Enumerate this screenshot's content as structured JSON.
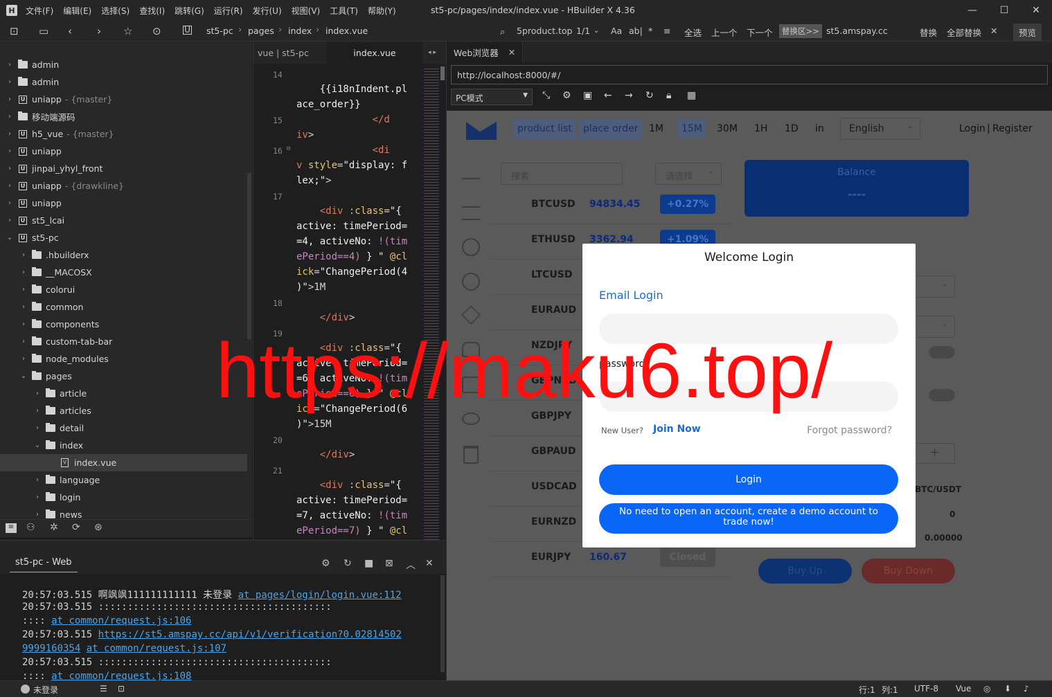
{
  "window": {
    "title": "st5-pc/pages/index/index.vue - HBuilder X 4.36",
    "logo": "H",
    "menu": [
      "文件(F)",
      "编辑(E)",
      "选择(S)",
      "查找(I)",
      "跳转(G)",
      "运行(R)",
      "发行(U)",
      "视图(V)",
      "工具(T)",
      "帮助(Y)"
    ],
    "controls": {
      "minimize": "—",
      "maximize": "☐",
      "close": "✕"
    }
  },
  "toolbar": {
    "breadcrumb": [
      "st5-pc",
      "pages",
      "index",
      "index.vue"
    ],
    "search_value": "5product.top",
    "search_count": "1/1",
    "search_options": [
      "Aa",
      "аb|",
      "*"
    ],
    "select_all": "全选",
    "prev": "上一个",
    "next": "下一个",
    "replace_area": "替换区>>",
    "replace_value": "st5.amspay.cc",
    "replace": "替换",
    "replace_all": "全部替换",
    "preview": "预览"
  },
  "sidebar": {
    "items": [
      {
        "label": "admin",
        "type": "folder",
        "depth": 0,
        "expanded": false,
        "branch": ""
      },
      {
        "label": "admin",
        "type": "folder",
        "depth": 0,
        "expanded": false,
        "branch": ""
      },
      {
        "label": "uniapp",
        "type": "uniapp",
        "depth": 0,
        "expanded": false,
        "branch": "- {master}"
      },
      {
        "label": "移动端源码",
        "type": "folder",
        "depth": 0,
        "expanded": false,
        "branch": ""
      },
      {
        "label": "h5_vue",
        "type": "uniapp",
        "depth": 0,
        "expanded": false,
        "branch": "- {master}"
      },
      {
        "label": "uniapp",
        "type": "uniapp",
        "depth": 0,
        "expanded": false,
        "branch": ""
      },
      {
        "label": "jinpai_yhyl_front",
        "type": "uniapp",
        "depth": 0,
        "expanded": false,
        "branch": ""
      },
      {
        "label": "uniapp",
        "type": "uniapp",
        "depth": 0,
        "expanded": false,
        "branch": "- {drawkline}"
      },
      {
        "label": "uniapp",
        "type": "uniapp",
        "depth": 0,
        "expanded": false,
        "branch": ""
      },
      {
        "label": "st5_lcai",
        "type": "uniapp",
        "depth": 0,
        "expanded": false,
        "branch": ""
      },
      {
        "label": "st5-pc",
        "type": "uniapp",
        "depth": 0,
        "expanded": true,
        "branch": ""
      },
      {
        "label": ".hbuilderx",
        "type": "folder",
        "depth": 1,
        "expanded": false,
        "branch": ""
      },
      {
        "label": "__MACOSX",
        "type": "folder",
        "depth": 1,
        "expanded": false,
        "branch": ""
      },
      {
        "label": "colorui",
        "type": "folder",
        "depth": 1,
        "expanded": false,
        "branch": ""
      },
      {
        "label": "common",
        "type": "folder",
        "depth": 1,
        "expanded": false,
        "branch": ""
      },
      {
        "label": "components",
        "type": "folder",
        "depth": 1,
        "expanded": false,
        "branch": ""
      },
      {
        "label": "custom-tab-bar",
        "type": "folder",
        "depth": 1,
        "expanded": false,
        "branch": ""
      },
      {
        "label": "node_modules",
        "type": "folder",
        "depth": 1,
        "expanded": false,
        "branch": ""
      },
      {
        "label": "pages",
        "type": "folder",
        "depth": 1,
        "expanded": true,
        "branch": ""
      },
      {
        "label": "article",
        "type": "folder",
        "depth": 2,
        "expanded": false,
        "branch": ""
      },
      {
        "label": "articles",
        "type": "folder",
        "depth": 2,
        "expanded": false,
        "branch": ""
      },
      {
        "label": "detail",
        "type": "folder",
        "depth": 2,
        "expanded": false,
        "branch": ""
      },
      {
        "label": "index",
        "type": "folder",
        "depth": 2,
        "expanded": true,
        "branch": ""
      },
      {
        "label": "index.vue",
        "type": "file",
        "depth": 3,
        "expanded": false,
        "branch": "",
        "selected": true
      },
      {
        "label": "language",
        "type": "folder",
        "depth": 2,
        "expanded": false,
        "branch": ""
      },
      {
        "label": "login",
        "type": "folder",
        "depth": 2,
        "expanded": false,
        "branch": ""
      },
      {
        "label": "news",
        "type": "folder",
        "depth": 2,
        "expanded": false,
        "branch": ""
      }
    ]
  },
  "editor": {
    "tabs": [
      {
        "label": "vue | st5-pc",
        "active": false
      },
      {
        "label": "index.vue",
        "active": true
      }
    ],
    "line_numbers": [
      "14",
      "15",
      "16",
      "17",
      "18",
      "19",
      "20",
      "21"
    ]
  },
  "panel": {
    "tab": "st5-pc - Web",
    "logs": [
      {
        "time": "20:57:03.515",
        "text": " 啊飒飒111111111111 未登录 ",
        "link": "at pages/login/login.vue:112"
      },
      {
        "time": "20:57:03.515",
        "text": " ::::::::::::::::::::::::::::::::::::::::",
        "link": ""
      },
      {
        "time": "",
        "text": ":::: ",
        "link": "at common/request.js:106"
      },
      {
        "time": "20:57:03.515",
        "text": " ",
        "link": "https://st5.amspay.cc/api/v1/verification?0.02814502"
      },
      {
        "time": "",
        "text": "",
        "link": "9999160354",
        "link2": "at common/request.js:107"
      },
      {
        "time": "20:57:03.515",
        "text": " ::::::::::::::::::::::::::::::::::::::::",
        "link": ""
      },
      {
        "time": "",
        "text": ":::: ",
        "link": "at common/request.js:108"
      }
    ]
  },
  "statusbar": {
    "login": "未登录",
    "line": "行:1",
    "col": "列:1",
    "encoding": "UTF-8",
    "lang": "Vue"
  },
  "browser": {
    "tab": "Web浏览器",
    "url": "http://localhost:8000/#/",
    "mode": "PC模式"
  },
  "site": {
    "nav": {
      "product_list": "product list",
      "place_order": "place order",
      "periods": [
        "1M",
        "15M",
        "30M",
        "1H",
        "1D"
      ],
      "in": "in",
      "language": "English",
      "login": "Login",
      "register": "Register"
    },
    "search_placeholder": "搜索",
    "select_placeholder": "请选择",
    "balance_label": "Balance",
    "balance_value": "----",
    "markets": [
      {
        "pair": "BTCUSD",
        "price": "94834.45",
        "change": "+0.27%"
      },
      {
        "pair": "ETHUSD",
        "price": "3362.94",
        "change": "+1.09%"
      },
      {
        "pair": "LTCUSD",
        "price": "",
        "change": ""
      },
      {
        "pair": "EURAUD",
        "price": "",
        "change": ""
      },
      {
        "pair": "NZDJPY",
        "price": "",
        "change": ""
      },
      {
        "pair": "GBPNZD",
        "price": "",
        "change": ""
      },
      {
        "pair": "GBPJPY",
        "price": "",
        "change": ""
      },
      {
        "pair": "GBPAUD",
        "price": "",
        "change": ""
      },
      {
        "pair": "USDCAD",
        "price": "",
        "change": ""
      },
      {
        "pair": "EURNZD",
        "price": "",
        "change": ""
      },
      {
        "pair": "EURJPY",
        "price": "160.67",
        "change": "Closed"
      }
    ],
    "right_panel": {
      "symbol": "BTC/USDT",
      "qty": "0",
      "amount": "0.00000",
      "buy_up": "Buy Up",
      "buy_down": "Buy Down"
    },
    "modal": {
      "title": "Welcome Login",
      "email_tab": "Email Login",
      "password_label": "password",
      "new_user": "New User?",
      "join_now": "Join Now",
      "forgot": "Forgot password?",
      "login_button": "Login",
      "demo_button": "No need to open an account, create a demo account to trade now!"
    }
  },
  "watermark": "https://maku6.top/"
}
